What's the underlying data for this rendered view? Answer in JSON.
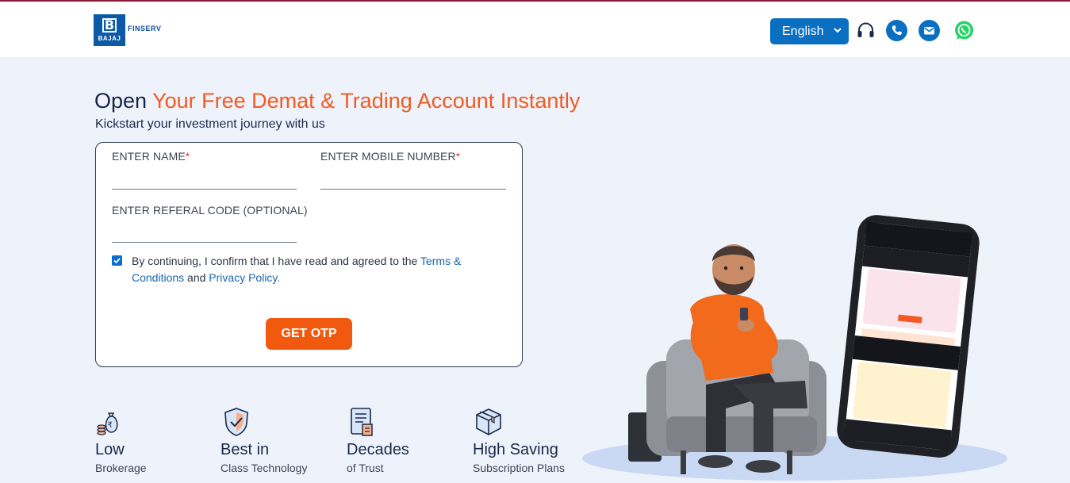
{
  "header": {
    "logo": {
      "box_text": "BAJAJ",
      "brand_text": "FINSERV"
    },
    "language": {
      "selected": "English"
    },
    "icons": [
      "headset-icon",
      "phone-icon",
      "mail-icon",
      "whatsapp-icon"
    ]
  },
  "hero": {
    "title_prefix": "Open",
    "title_accent": "Your Free Demat & Trading Account Instantly",
    "subtitle": "Kickstart your investment journey with us"
  },
  "form": {
    "name_label": "ENTER NAME",
    "mobile_label": "ENTER MOBILE NUMBER",
    "referral_label": "ENTER REFERAL CODE (OPTIONAL)",
    "required_mark": "*",
    "consent_checked": true,
    "consent_text": "By continuing, I confirm that I have read and agreed to the",
    "terms_link": "Terms & Conditions",
    "consent_and": "and",
    "privacy_link": "Privacy Policy.",
    "submit_label": "GET OTP"
  },
  "features": [
    {
      "title": "Low",
      "subtitle": "Brokerage",
      "icon": "money-bag-icon"
    },
    {
      "title": "Best in",
      "subtitle": "Class Technology",
      "icon": "shield-check-icon"
    },
    {
      "title": "Decades",
      "subtitle": "of Trust",
      "icon": "document-icon"
    },
    {
      "title": "High Saving",
      "subtitle": "Subscription Plans",
      "icon": "package-icon"
    }
  ],
  "colors": {
    "accent": "#f15a22",
    "primary": "#0a6fc1",
    "background": "#eef3fb",
    "whatsapp": "#25d366"
  }
}
